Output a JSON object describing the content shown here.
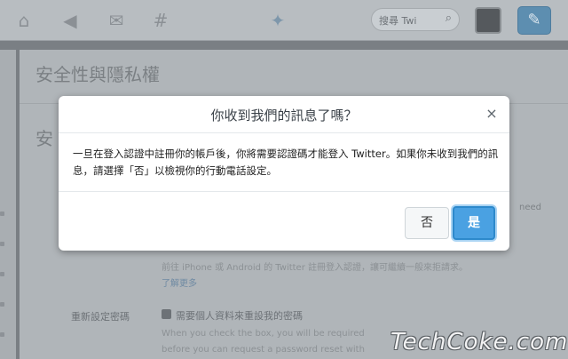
{
  "topbar": {
    "icons": [
      "home-icon",
      "notifications-icon",
      "messages-icon",
      "discover-icon"
    ],
    "search_placeholder": "搜尋 Twi",
    "brand_icon": "twitter-bird-icon",
    "compose_icon": "compose-tweet-icon"
  },
  "background": {
    "title": "安全性與隱私權",
    "h2": "安",
    "right_text": "need",
    "note": "前往 iPhone 或 Android 的 Twitter 註冊登入認證，讓可繼續一般來拒請求。",
    "link": "了解更多",
    "password_reset_label": "重新設定密碼",
    "password_reset_check": "需要個人資料來重設我的密碼",
    "help_line1": "When you check the box, you will be required",
    "help_line2": "before you can request a password reset with"
  },
  "modal": {
    "title": "你收到我們的訊息了嗎？",
    "body": "一旦在登入認證中註冊你的帳戶後，你將需要認證碼才能登入 Twitter。如果你未收到我們的訊息，請選擇「否」以檢視你的行動電話設定。",
    "no_label": "否",
    "yes_label": "是",
    "close_label": "×"
  },
  "watermark": "TechCoke.com",
  "colors": {
    "accent": "#4aa1e2",
    "overlay": "#7a7f84"
  }
}
